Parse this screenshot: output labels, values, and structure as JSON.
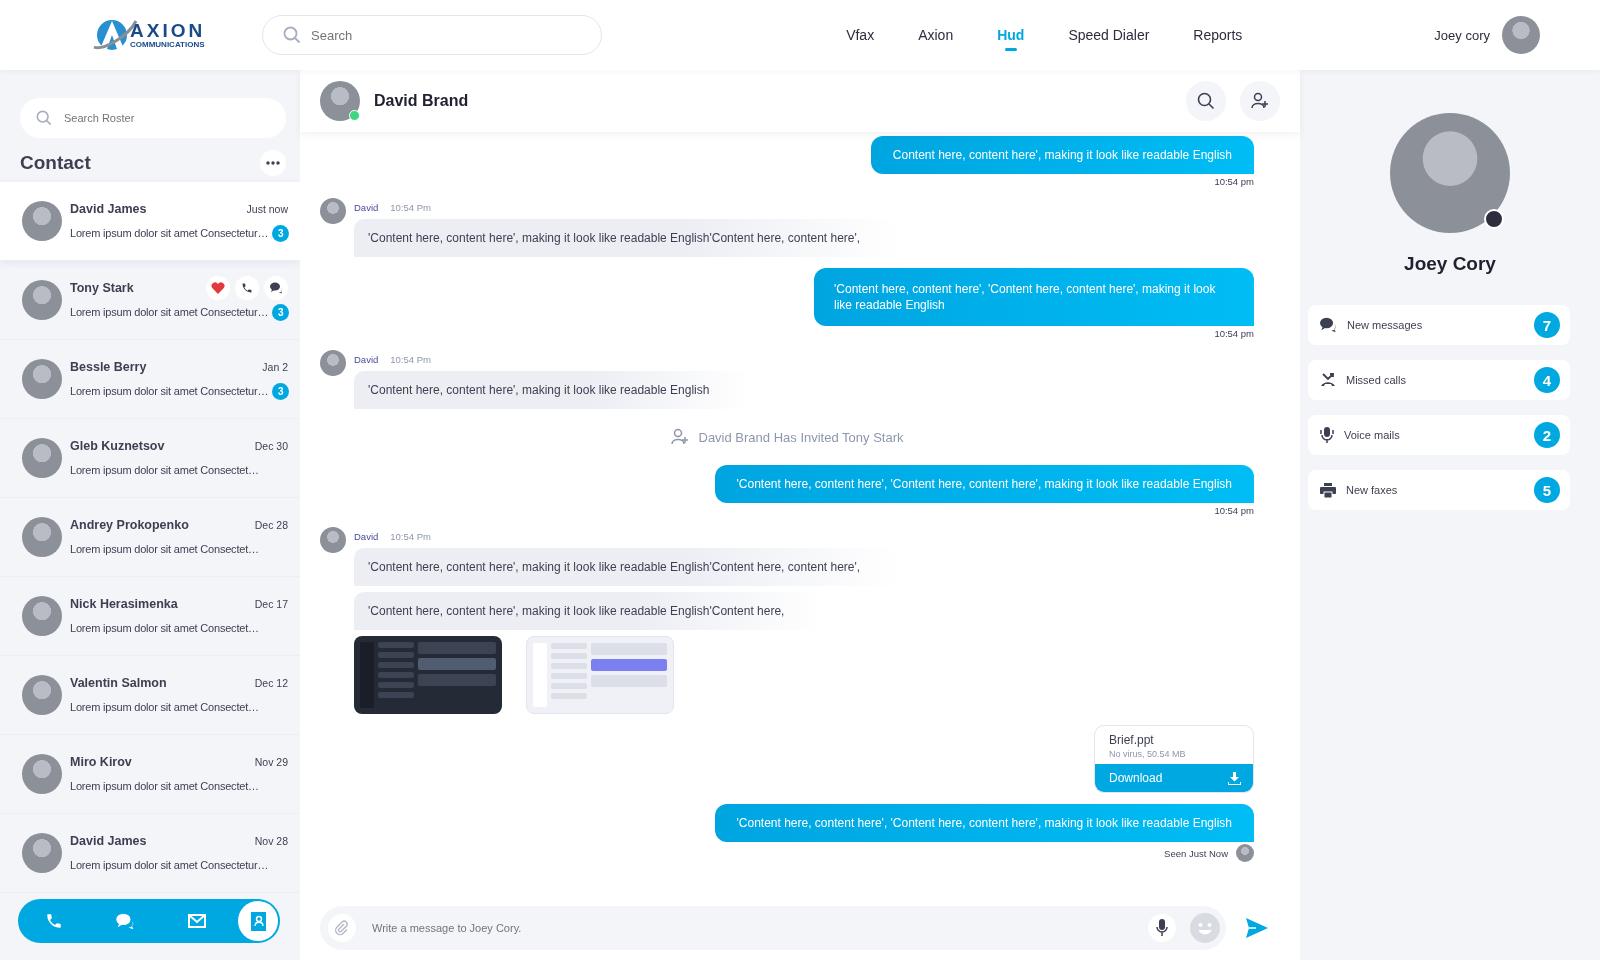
{
  "logo": {
    "wordmark": "AXION",
    "tagline": "COMMUNICATIONS"
  },
  "search": {
    "placeholder": "Search"
  },
  "nav": [
    {
      "label": "Vfax",
      "selected": false
    },
    {
      "label": "Axion",
      "selected": false
    },
    {
      "label": "Hud",
      "selected": true
    },
    {
      "label": "Speed Dialer",
      "selected": false
    },
    {
      "label": "Reports",
      "selected": false
    }
  ],
  "user": {
    "name": "Joey cory"
  },
  "sidebar": {
    "search_placeholder": "Search Roster",
    "title": "Contact",
    "contacts": [
      {
        "name": "David James",
        "time": "Just now",
        "preview": "Lorem ipsum dolor sit amet Consectetur…",
        "badge": "3",
        "selected": true,
        "hovered": false
      },
      {
        "name": "Tony Stark",
        "preview": "Lorem ipsum dolor sit amet Consectetur…",
        "badge": "3",
        "selected": false,
        "hovered": true
      },
      {
        "name": "Bessle Berry",
        "time": "Jan 2",
        "preview": "Lorem ipsum dolor sit amet Consectetur…",
        "badge": "3",
        "selected": false,
        "hovered": false
      },
      {
        "name": "Gleb Kuznetsov",
        "time": "Dec 30",
        "preview": "Lorem ipsum dolor sit amet Consectet…",
        "selected": false,
        "hovered": false
      },
      {
        "name": "Andrey Prokopenko",
        "time": "Dec 28",
        "preview": "Lorem ipsum dolor sit amet Consectet…",
        "selected": false,
        "hovered": false
      },
      {
        "name": "Nick Herasimenka",
        "time": "Dec 17",
        "preview": "Lorem ipsum dolor sit amet Consectet…",
        "selected": false,
        "hovered": false
      },
      {
        "name": "Valentin Salmon",
        "time": "Dec 12",
        "preview": "Lorem ipsum dolor sit amet Consectet…",
        "selected": false,
        "hovered": false
      },
      {
        "name": "Miro Kirov",
        "time": "Nov 29",
        "preview": "Lorem ipsum dolor sit amet Consectet…",
        "selected": false,
        "hovered": false
      },
      {
        "name": "David James",
        "time": "Nov 28",
        "preview": "Lorem ipsum dolor sit amet Consectetur…",
        "selected": false,
        "hovered": false
      }
    ],
    "bottom_nav": [
      {
        "kind": "phone",
        "selected": false
      },
      {
        "kind": "chat",
        "selected": false
      },
      {
        "kind": "mail",
        "selected": false
      },
      {
        "kind": "contacts",
        "selected": true
      }
    ]
  },
  "chat": {
    "contact": {
      "name": "David Brand",
      "online": true
    },
    "messages": [
      {
        "kind": "outgoing",
        "text": "Content here, content here', making it look like readable English",
        "time": "10:54 pm"
      },
      {
        "kind": "incoming",
        "sender": "David",
        "time": "10:54 Pm",
        "bubbles": [
          "'Content here, content here', making it look like readable English'Content here, content here',"
        ]
      },
      {
        "kind": "outgoing",
        "text": "'Content here, content here', 'Content here, content here', making it look like readable English",
        "time": "10:54 pm",
        "wrap": true
      },
      {
        "kind": "incoming",
        "sender": "David",
        "time": "10:54 Pm",
        "bubbles": [
          "'Content here, content here', making it look like readable English"
        ]
      },
      {
        "kind": "system",
        "text": "David Brand Has Invited Tony Stark"
      },
      {
        "kind": "outgoing",
        "text": "'Content here, content here', 'Content here, content here', making it look like readable English",
        "time": "10:54 pm"
      },
      {
        "kind": "incoming",
        "sender": "David",
        "time": "10:54 Pm",
        "bubbles": [
          "'Content here, content here', making it look like readable English'Content here, content here',",
          "'Content here, content here', making it look like readable English'Content here,"
        ],
        "images": [
          {
            "kind": "dark"
          },
          {
            "kind": "light"
          }
        ]
      },
      {
        "kind": "file",
        "name": "Brief.ppt",
        "info": "No virus, 50.54 MB",
        "action": "Download"
      },
      {
        "kind": "outgoing",
        "text": "'Content here, content here', 'Content here, content here', making it look like readable English",
        "time": "Seen Just Now",
        "seen": true
      }
    ],
    "composer": {
      "placeholder": "Write a message to Joey Cory."
    }
  },
  "profile": {
    "name": "Joey Cory",
    "online": false,
    "stats": [
      {
        "kind": "messages",
        "label": "New messages",
        "count": "7"
      },
      {
        "kind": "missed",
        "label": "Missed calls",
        "count": "4"
      },
      {
        "kind": "voicemail",
        "label": "Voice mails",
        "count": "2"
      },
      {
        "kind": "fax",
        "label": "New faxes",
        "count": "5"
      }
    ]
  }
}
